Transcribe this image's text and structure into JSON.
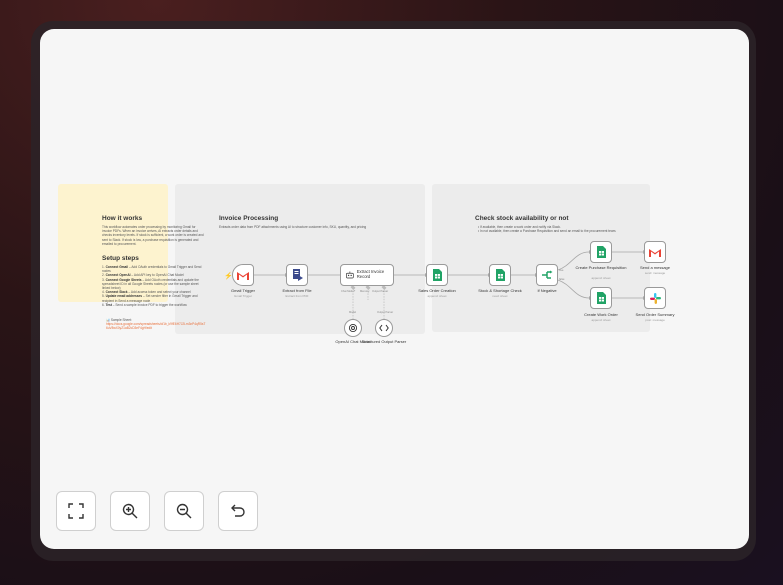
{
  "sticky_how": {
    "title": "How it works",
    "body": "This workflow automates order processing by monitoring Gmail for invoice PDFs. When an invoice arrives, AI extracts order details and checks inventory levels. If stock is sufficient, a work order is created and sent to Slack. If stock is low, a purchase requisition is generated and emailed to procurement.",
    "setup_title": "Setup steps",
    "steps": [
      {
        "n": "1.",
        "strong": "Connect Gmail",
        "text": " – Add OAuth credentials to Gmail Trigger and Send nodes"
      },
      {
        "n": "2.",
        "strong": "Connect OpenAI",
        "text": " – Add API key to OpenAI Chat Model"
      },
      {
        "n": "3.",
        "strong": "Connect Google Sheets",
        "text": " – Add OAuth credentials and update the spreadsheet ID in all Google Sheets nodes (or use the sample sheet linked below)"
      },
      {
        "n": "4.",
        "strong": "Connect Slack",
        "text": " – Add access token and select your channel"
      },
      {
        "n": "5.",
        "strong": "Update email addresses",
        "text": " – Set sender filter in Gmail Trigger and recipient in Send a message node"
      },
      {
        "n": "6.",
        "strong": "Test",
        "text": " – Send a sample invoice PDF to trigger the workflow"
      }
    ],
    "sample_label": "📊 Sample Sheet:",
    "sample_link": "https://docs.google.com/spreadsheets/d/1b_k9fE6H7J2Lm3nP4qR5sT6uV8wX0yZ1aB2cD3eF4gH/edit"
  },
  "sticky_invoice": {
    "title": "Invoice Processing",
    "desc": "Extracts order data from PDF attachments using AI to structure customer info, SKU, quantity, and pricing"
  },
  "sticky_stock": {
    "title": "Check stock availability or not",
    "bullets": [
      "• If available, then create a work order and notify via Slack.",
      "• In not available, then create a Purchase Requisition and send an email to the procurement team."
    ]
  },
  "nodes": {
    "gmail_trigger": {
      "label": "Gmail Trigger",
      "sub": "Gmail Trigger"
    },
    "extract_file": {
      "label": "Extract from File",
      "sub": "Extract from PDF"
    },
    "extract_invoice": {
      "label": "Extract Invoice Record"
    },
    "sales_order": {
      "label": "Sales Order Creation",
      "sub": "append: sheet"
    },
    "stock_check": {
      "label": "Stock & Shortage Check",
      "sub": "read: sheet"
    },
    "if_negative": {
      "label": "If Negative"
    },
    "purchase_req": {
      "label": "Create Purchase Requisition",
      "sub": "append: sheet"
    },
    "send_message": {
      "label": "Send a message",
      "sub": "send: message"
    },
    "work_order": {
      "label": "Create Work Order",
      "sub": "append: sheet"
    },
    "order_summary": {
      "label": "Send Order Summary",
      "sub": "post: message"
    },
    "openai_model": {
      "label": "OpenAI Chat Model"
    },
    "output_parser": {
      "label": "Structured Output Parser"
    }
  },
  "ports": {
    "chat_model": "Chat Model*",
    "memory": "Memory",
    "output_parser": "Output Parser",
    "model": "Model",
    "true": "true",
    "false": "false"
  },
  "controls": {
    "fit": "fit-view-icon",
    "zoom_in": "zoom-in-icon",
    "zoom_out": "zoom-out-icon",
    "undo": "undo-icon"
  },
  "colors": {
    "sticky_yellow": "#fdf3cf",
    "sticky_gray": "#ececec",
    "sheets_green": "#21a366",
    "gmail_red": "#ea4335",
    "link_orange": "#e86f3a"
  }
}
